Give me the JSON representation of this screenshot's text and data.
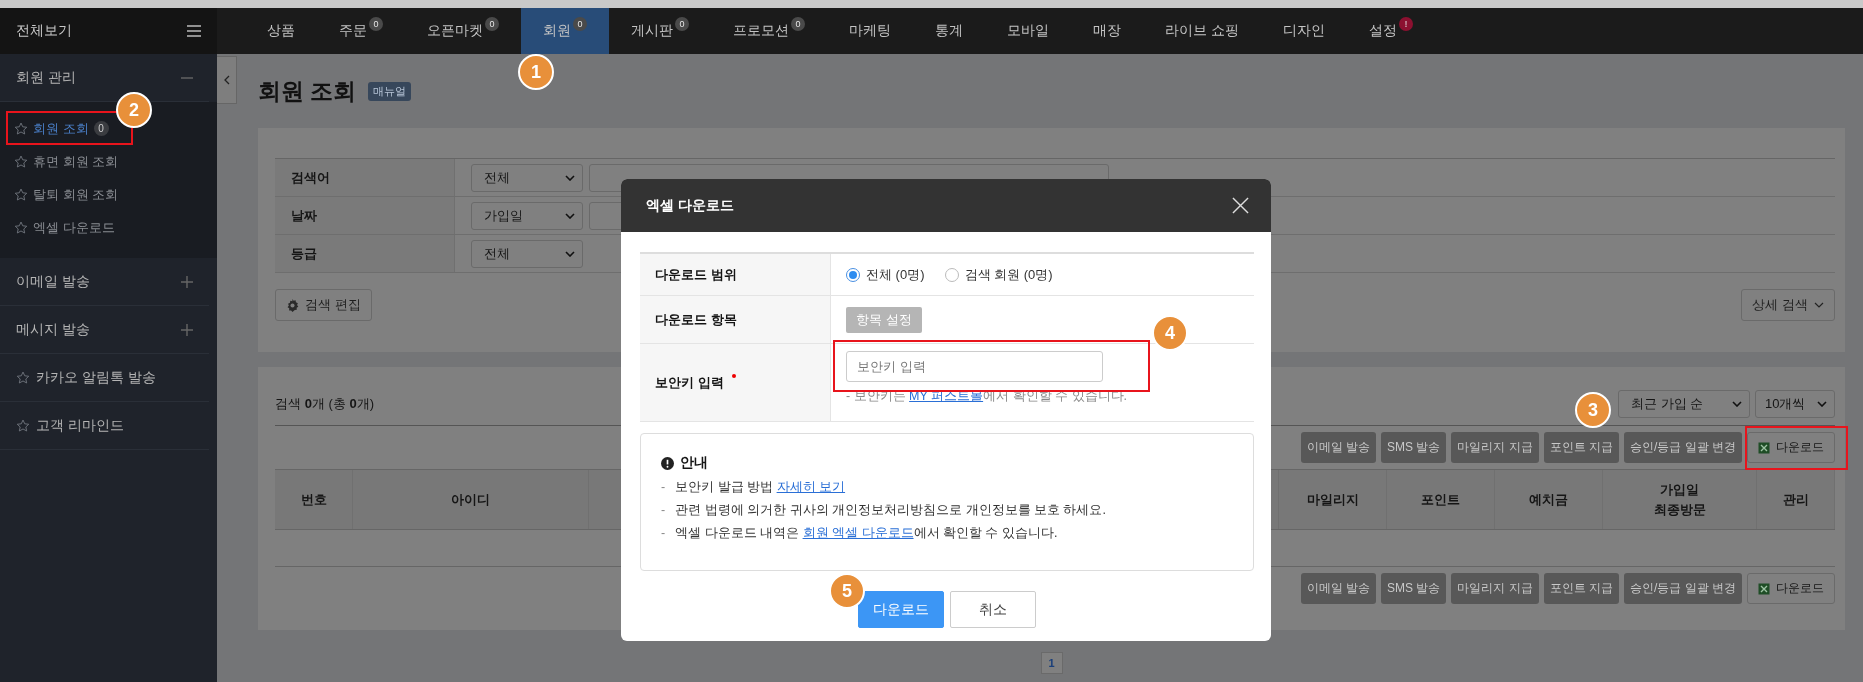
{
  "nav": {
    "menu_label": "전체보기",
    "items": [
      {
        "label": "상품",
        "selected": false
      },
      {
        "label": "주문",
        "badge": {
          "text": "0",
          "kind": "count"
        },
        "selected": false
      },
      {
        "label": "오픈마켓",
        "badge": {
          "text": "0",
          "kind": "count"
        },
        "selected": false
      },
      {
        "label": "회원",
        "badge": {
          "text": "0",
          "kind": "count"
        },
        "selected": true,
        "marker": "1"
      },
      {
        "label": "게시판",
        "badge": {
          "text": "0",
          "kind": "count"
        },
        "selected": false
      },
      {
        "label": "프로모션",
        "badge": {
          "text": "0",
          "kind": "count"
        },
        "selected": false
      },
      {
        "label": "마케팅",
        "selected": false
      },
      {
        "label": "통계",
        "selected": false
      },
      {
        "label": "모바일",
        "selected": false
      },
      {
        "label": "매장",
        "selected": false
      },
      {
        "label": "라이브 쇼핑",
        "selected": false
      },
      {
        "label": "디자인",
        "selected": false
      },
      {
        "label": "설정",
        "badge": {
          "text": "!",
          "kind": "alert"
        },
        "selected": false
      }
    ]
  },
  "sidebar": {
    "groups": [
      {
        "kind": "group",
        "label": "회원 관리",
        "expanded": true,
        "children": [
          {
            "label": "회원 조회",
            "badge": "0",
            "selected": true,
            "highlighted": true,
            "marker": "2"
          },
          {
            "label": "휴면 회원 조회",
            "selected": false
          },
          {
            "label": "탈퇴 회원 조회",
            "selected": false
          },
          {
            "label": "엑셀 다운로드",
            "selected": false
          }
        ]
      },
      {
        "kind": "group",
        "label": "이메일 발송",
        "expanded": false
      },
      {
        "kind": "group",
        "label": "메시지 발송",
        "expanded": false
      },
      {
        "kind": "link",
        "label": "카카오 알림톡 발송"
      },
      {
        "kind": "link",
        "label": "고객 리마인드"
      }
    ]
  },
  "page": {
    "title": "회원 조회",
    "manual_badge": "매뉴얼",
    "search_form": {
      "rows": [
        {
          "label": "검색어",
          "select": "전체",
          "has_input": true
        },
        {
          "label": "날짜",
          "select": "가입일",
          "has_input": true
        },
        {
          "label": "등급",
          "select": "전체",
          "has_input": false
        }
      ],
      "edit_button": "검색 편집",
      "detail_button": "상세 검색"
    },
    "results": {
      "summary": "검색 **0**개 (총 **0**개)",
      "sort": "최근 가입 순",
      "per_page": "10개씩",
      "actions": [
        {
          "label": "이메일 발송",
          "kind": "action"
        },
        {
          "label": "SMS 발송",
          "kind": "action"
        },
        {
          "label": "마일리지 지급",
          "kind": "action"
        },
        {
          "label": "포인트 지급",
          "kind": "action"
        },
        {
          "label": "승인/등급 일괄 변경",
          "kind": "action"
        },
        {
          "label": "다운로드",
          "kind": "excel",
          "highlighted": true,
          "marker": "3"
        }
      ],
      "columns": [
        "번호",
        "아이디",
        "마일리지",
        "포인트",
        "예치금",
        "가입일\n최종방문",
        "관리"
      ],
      "bottom_actions": [
        {
          "label": "이메일 발송",
          "kind": "action"
        },
        {
          "label": "SMS 발송",
          "kind": "action"
        },
        {
          "label": "마일리지 지급",
          "kind": "action"
        },
        {
          "label": "포인트 지급",
          "kind": "action"
        },
        {
          "label": "승인/등급 일괄 변경",
          "kind": "action"
        },
        {
          "label": "다운로드",
          "kind": "excel"
        }
      ]
    },
    "pagination": [
      {
        "label": "1",
        "selected": true
      }
    ]
  },
  "modal": {
    "title": "엑셀 다운로드",
    "rows": [
      {
        "kind": "radios",
        "label": "다운로드 범위",
        "options": [
          {
            "label": "전체 (0명)",
            "selected": true
          },
          {
            "label": "검색 회원 (0명)",
            "selected": false
          }
        ]
      },
      {
        "kind": "button",
        "label": "다운로드 항목",
        "button": "항목 설정"
      },
      {
        "kind": "secure_input",
        "label": "보안키 입력",
        "required": true,
        "placeholder": "보안키 입력",
        "highlighted": true,
        "marker": "4",
        "hint": {
          "before": "- 보안키는 ",
          "link": "MY 퍼스트몰",
          "after": "에서 확인할 수 있습니다."
        }
      }
    ],
    "notice": {
      "title": "안내",
      "lines": [
        {
          "dash": "-",
          "before": "보안키 발급 방법 ",
          "link": "자세히 보기"
        },
        {
          "dash": "-",
          "before": "관련 법령에 의거한 귀사의 개인정보처리방침으로 개인정보를 보호 하세요."
        },
        {
          "dash": "-",
          "before": "엑셀 다운로드 내역은 ",
          "link": "회원 엑셀 다운로드",
          "after": "에서 확인할 수 있습니다."
        }
      ]
    },
    "buttons": [
      {
        "label": "다운로드",
        "kind": "primary",
        "marker": "5"
      },
      {
        "label": "취소",
        "kind": "secondary"
      }
    ]
  }
}
